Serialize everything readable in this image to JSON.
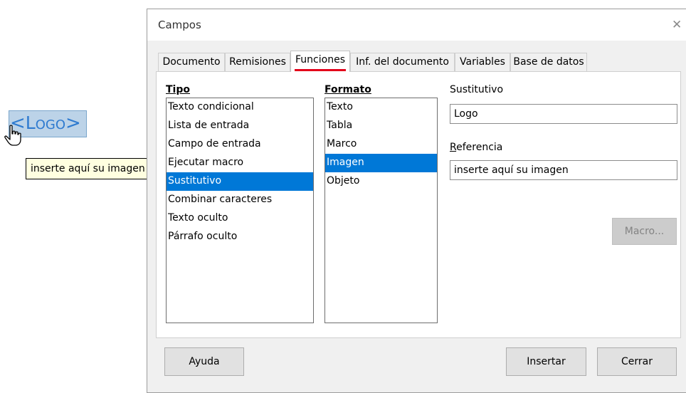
{
  "document": {
    "placeholder": {
      "lt": "<",
      "first": "L",
      "rest": "OGO",
      "gt": ">"
    },
    "tooltip": "inserte aquí su imagen"
  },
  "dialog": {
    "title": "Campos",
    "tabs": [
      "Documento",
      "Remisiones",
      "Funciones",
      "Inf. del documento",
      "Variables",
      "Base de datos"
    ],
    "active_tab": "Funciones",
    "tipo": {
      "label": "Tipo",
      "items": [
        "Texto condicional",
        "Lista de entrada",
        "Campo de entrada",
        "Ejecutar macro",
        "Sustitutivo",
        "Combinar caracteres",
        "Texto oculto",
        "Párrafo oculto"
      ],
      "selected": "Sustitutivo"
    },
    "formato": {
      "label": "Formato",
      "items": [
        "Texto",
        "Tabla",
        "Marco",
        "Imagen",
        "Objeto"
      ],
      "selected": "Imagen"
    },
    "sustitutivo": {
      "label": "Sustitutivo",
      "value": "Logo"
    },
    "referencia": {
      "label": "Referencia",
      "value": "inserte aquí su imagen"
    },
    "buttons": {
      "macro": "Macro...",
      "help": "Ayuda",
      "insert": "Insertar",
      "close": "Cerrar"
    }
  },
  "colors": {
    "selection": "#0078d7",
    "tab_underline": "#e3001b",
    "placeholder_text": "#2f7bd0"
  }
}
